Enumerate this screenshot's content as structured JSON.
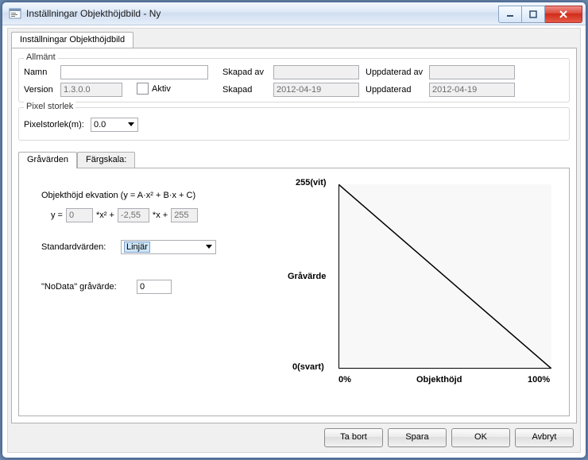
{
  "window": {
    "title": "Inställningar Objekthöjdbild - Ny"
  },
  "outer_tab": {
    "label": "Inställningar Objekthöjdbild"
  },
  "general": {
    "legend": "Allmänt",
    "name_label": "Namn",
    "name_value": "",
    "version_label": "Version",
    "version_value": "1.3.0.0",
    "active_label": "Aktiv",
    "created_by_label": "Skapad av",
    "created_by_value": "",
    "created_label": "Skapad",
    "created_value": "2012-04-19",
    "updated_by_label": "Uppdaterad av",
    "updated_by_value": "",
    "updated_label": "Uppdaterad",
    "updated_value": "2012-04-19"
  },
  "pixel": {
    "legend": "Pixel storlek",
    "label": "Pixelstorlek(m):",
    "value": "0.0"
  },
  "inner_tabs": {
    "tab1": "Gråvärden",
    "tab2": "Färgskala:"
  },
  "equation": {
    "title": "Objekthöjd ekvation (y = A·x² + B·x + C)",
    "y_eq": "y =",
    "a": "0",
    "x2_plus": "*x² +",
    "b": "-2,55",
    "x_plus": "*x +",
    "c": "255",
    "std_label": "Standardvärden:",
    "std_value": "Linjär",
    "nodata_label": "\"NoData\" gråvärde:",
    "nodata_value": "0"
  },
  "chart_data": {
    "type": "line",
    "x": [
      0,
      100
    ],
    "y": [
      255,
      0
    ],
    "title": "",
    "y_top_label": "255(vit)",
    "y_bottom_label": "0(svart)",
    "y_axis_label": "Gråvärde",
    "x_left_label": "0%",
    "x_right_label": "100%",
    "x_axis_label": "Objekthöjd",
    "xlim": [
      0,
      100
    ],
    "ylim": [
      0,
      255
    ]
  },
  "buttons": {
    "delete": "Ta bort",
    "save": "Spara",
    "ok": "OK",
    "cancel": "Avbryt"
  }
}
